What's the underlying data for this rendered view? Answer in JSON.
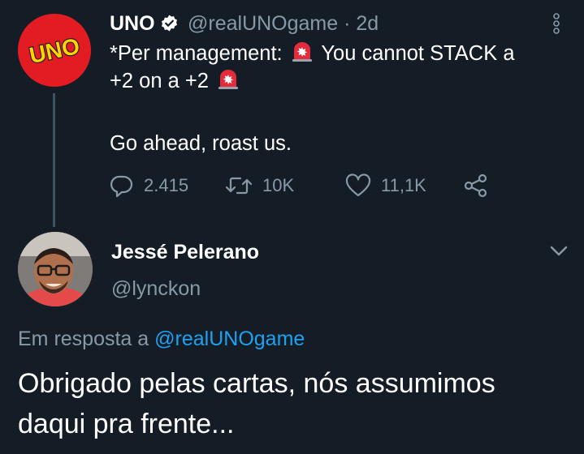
{
  "original_tweet": {
    "avatar_logo_text": "UNO",
    "author_name": "UNO",
    "handle_time": "@realUNOgame · 2d",
    "text_prefix": "*Per management:",
    "text_middle": "You cannot STACK a",
    "text_line2": "+2 on a +2",
    "text_line3": "Go ahead, roast us.",
    "emoji": "rotating-light",
    "stats": {
      "replies": "2.415",
      "retweets": "10K",
      "likes": "11,1K"
    }
  },
  "reply_tweet": {
    "author_name": "Jessé Pelerano",
    "handle": "@lynckon",
    "reply_prefix": "Em resposta a",
    "reply_mention": "@realUNOgame",
    "text": "Obrigado pelas cartas, nós assumimos daqui pra frente..."
  },
  "colors": {
    "background": "#141d26",
    "secondary_text": "#8899a6",
    "link": "#1da1f2",
    "uno_red": "#e31b23",
    "uno_yellow": "#ffd400"
  },
  "icons": [
    "verified-badge-icon",
    "more-options-icon",
    "reply-icon",
    "retweet-icon",
    "like-icon",
    "share-icon",
    "chevron-down-icon",
    "siren-emoji-icon"
  ]
}
